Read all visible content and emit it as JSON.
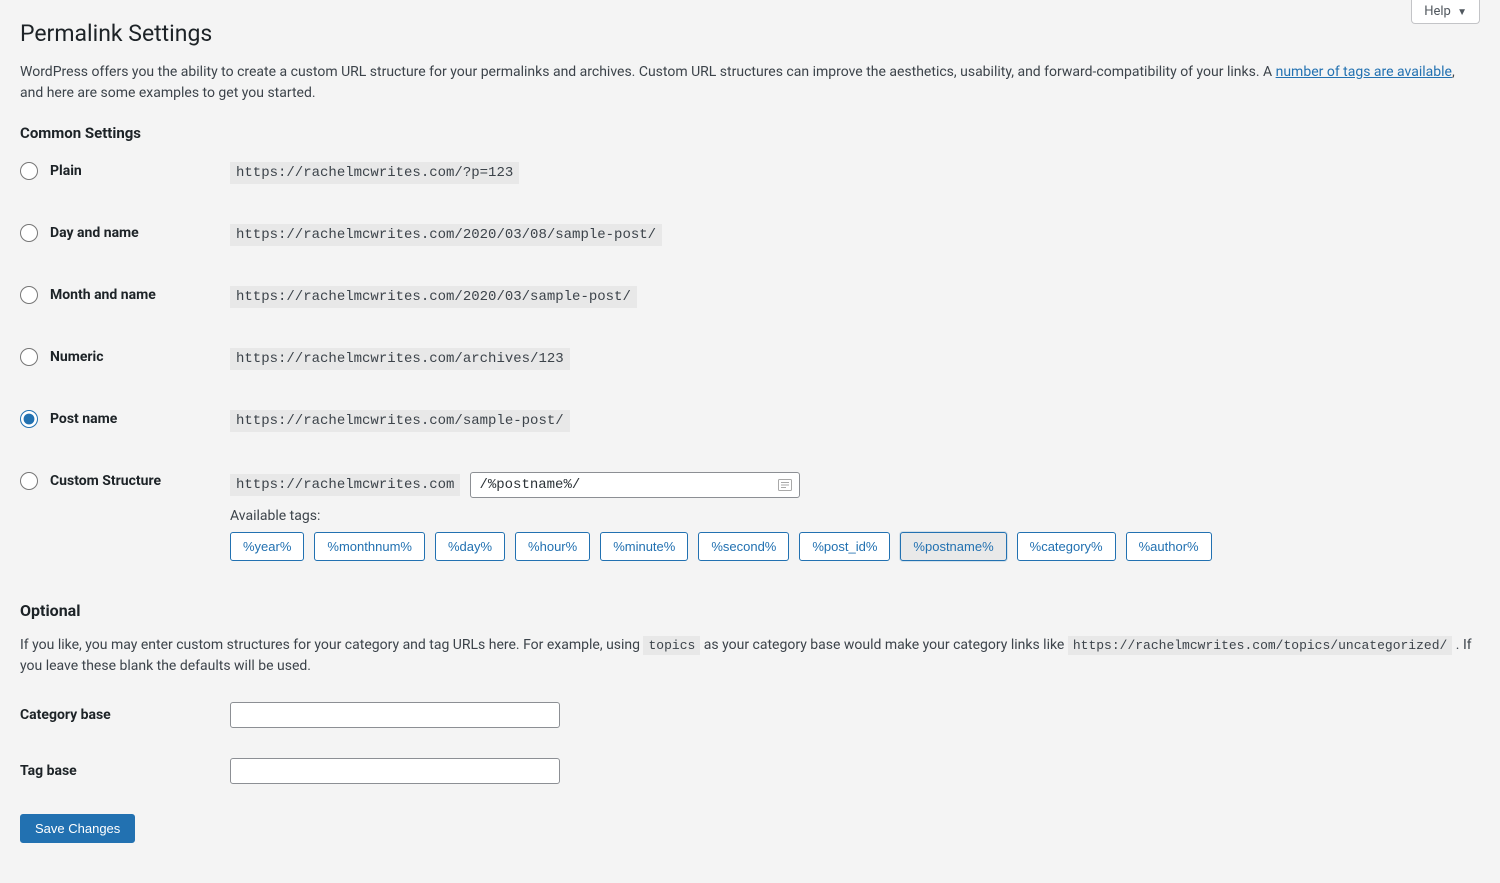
{
  "help_label": "Help",
  "page_title": "Permalink Settings",
  "intro_text_pre": "WordPress offers you the ability to create a custom URL structure for your permalinks and archives. Custom URL structures can improve the aesthetics, usability, and forward-compatibility of your links. A ",
  "intro_link_text": "number of tags are available",
  "intro_text_post": ", and here are some examples to get you started.",
  "common_heading": "Common Settings",
  "options": [
    {
      "label": "Plain",
      "url": "https://rachelmcwrites.com/?p=123",
      "checked": false
    },
    {
      "label": "Day and name",
      "url": "https://rachelmcwrites.com/2020/03/08/sample-post/",
      "checked": false
    },
    {
      "label": "Month and name",
      "url": "https://rachelmcwrites.com/2020/03/sample-post/",
      "checked": false
    },
    {
      "label": "Numeric",
      "url": "https://rachelmcwrites.com/archives/123",
      "checked": false
    },
    {
      "label": "Post name",
      "url": "https://rachelmcwrites.com/sample-post/",
      "checked": true
    }
  ],
  "custom": {
    "label": "Custom Structure",
    "checked": false,
    "base_url": "https://rachelmcwrites.com",
    "value": "/%postname%/",
    "available_tags_label": "Available tags:",
    "tags": [
      {
        "text": "%year%",
        "active": false
      },
      {
        "text": "%monthnum%",
        "active": false
      },
      {
        "text": "%day%",
        "active": false
      },
      {
        "text": "%hour%",
        "active": false
      },
      {
        "text": "%minute%",
        "active": false
      },
      {
        "text": "%second%",
        "active": false
      },
      {
        "text": "%post_id%",
        "active": false
      },
      {
        "text": "%postname%",
        "active": true
      },
      {
        "text": "%category%",
        "active": false
      },
      {
        "text": "%author%",
        "active": false
      }
    ]
  },
  "optional": {
    "heading": "Optional",
    "desc_pre": "If you like, you may enter custom structures for your category and tag URLs here. For example, using ",
    "desc_code1": "topics",
    "desc_mid": " as your category base would make your category links like ",
    "desc_code2": "https://rachelmcwrites.com/topics/uncategorized/",
    "desc_post": " . If you leave these blank the defaults will be used.",
    "category_label": "Category base",
    "category_value": "",
    "tag_label": "Tag base",
    "tag_value": ""
  },
  "submit_label": "Save Changes"
}
